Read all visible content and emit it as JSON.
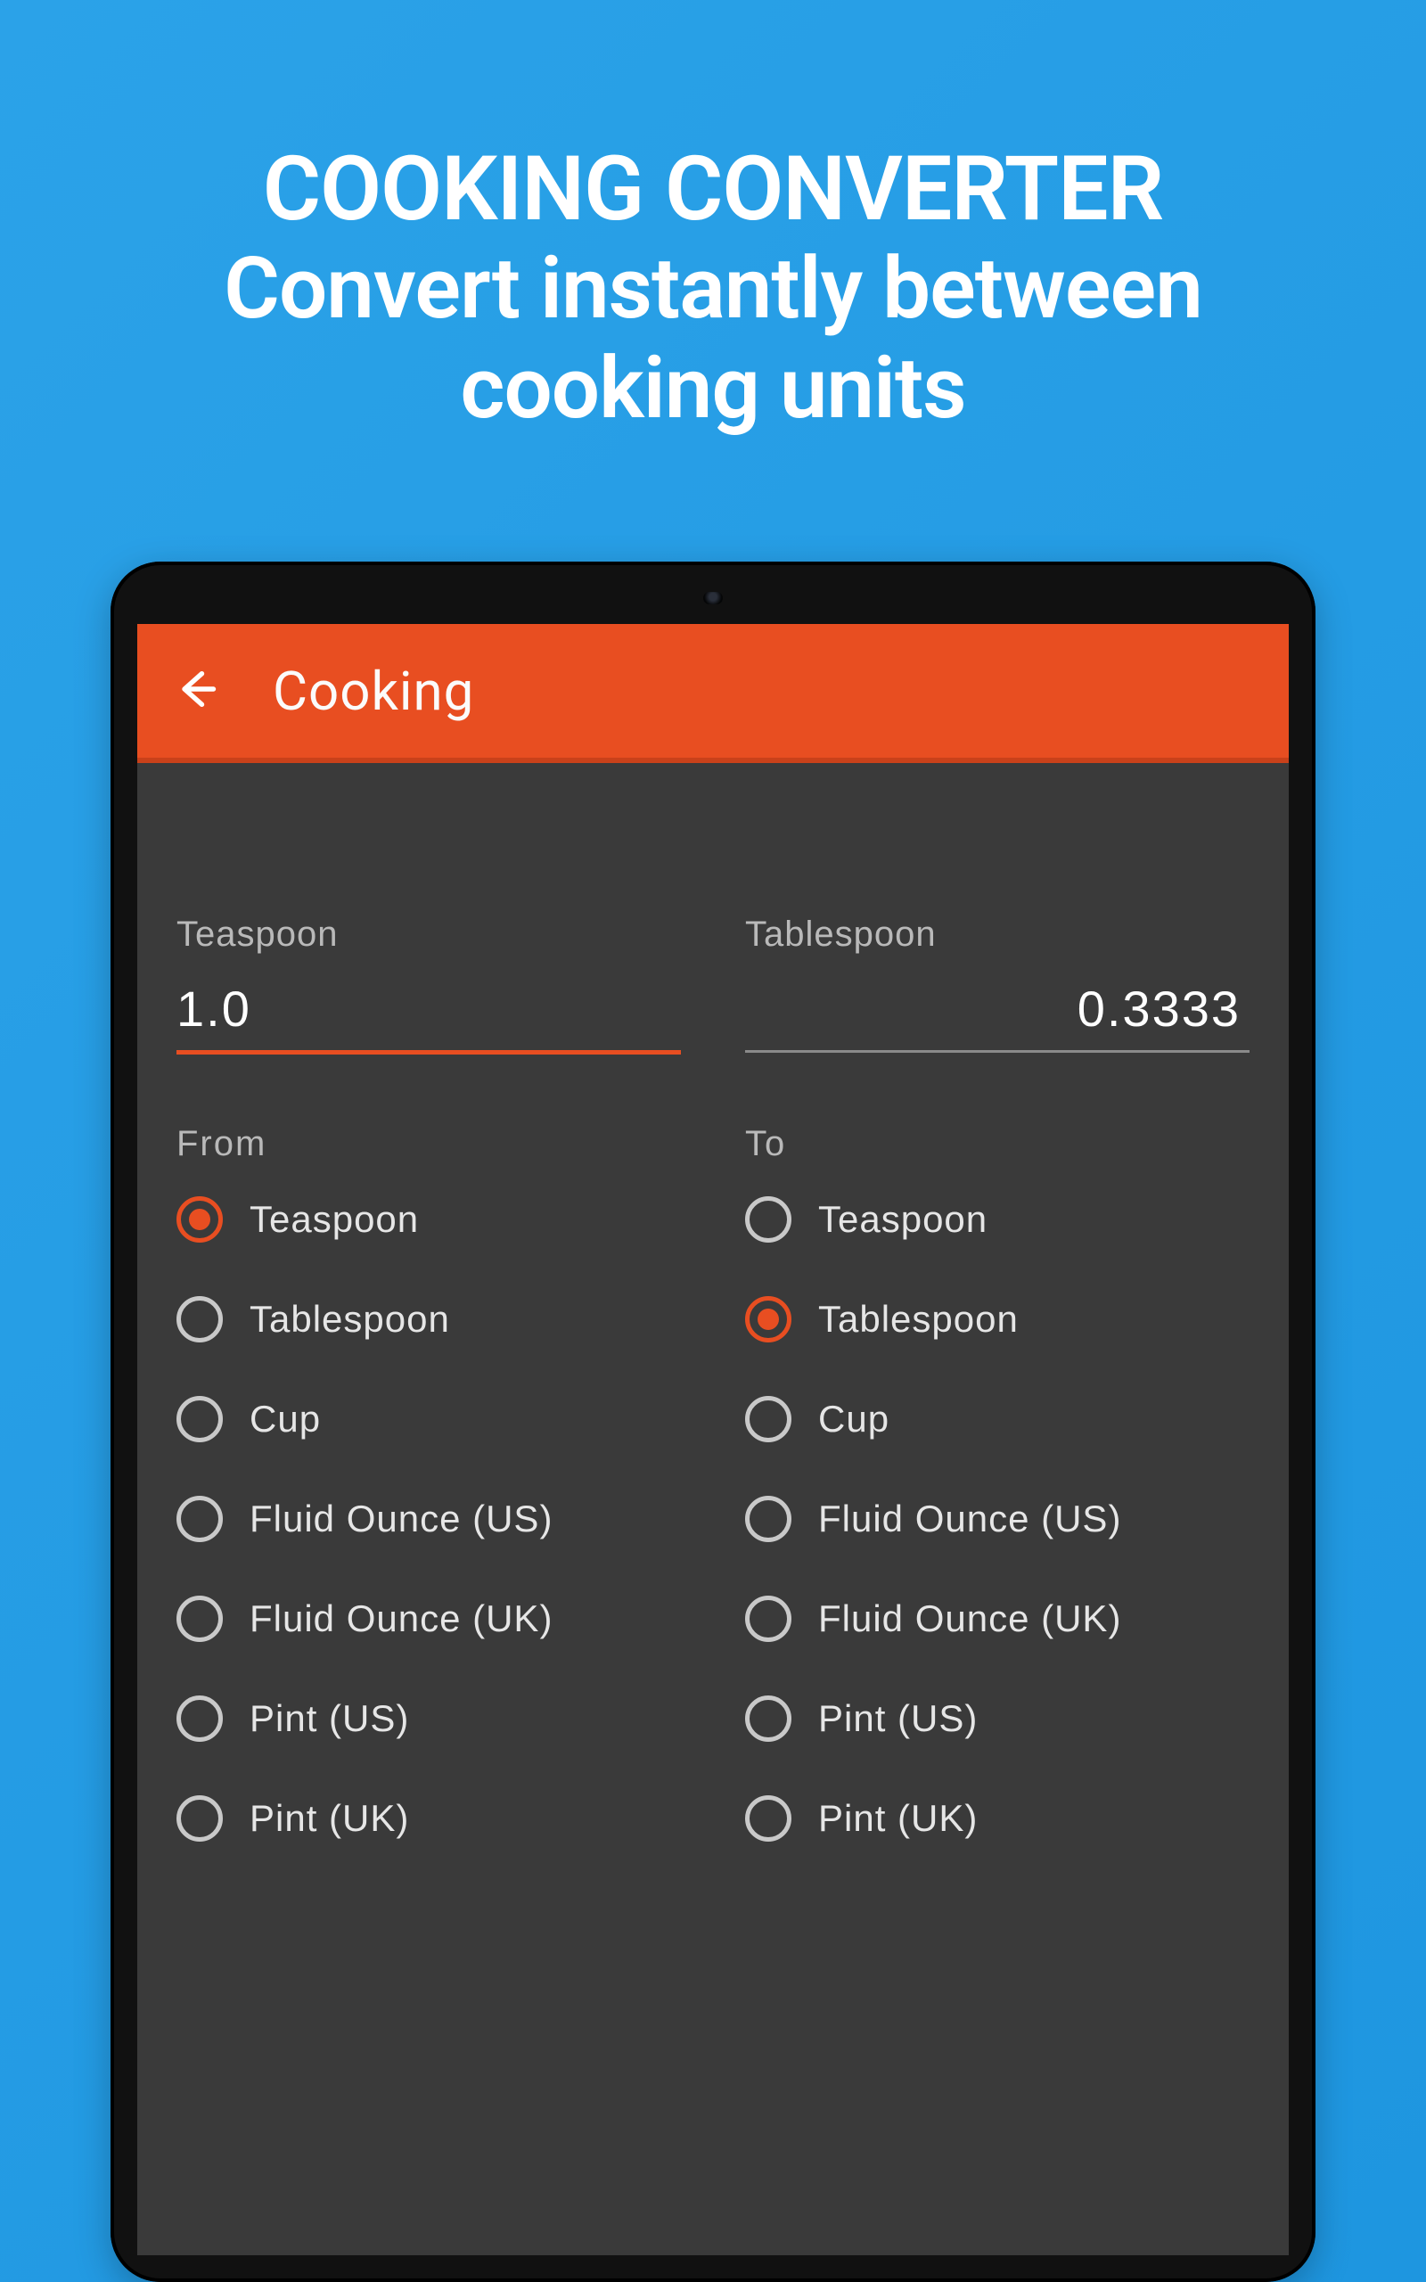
{
  "promo": {
    "title": "COOKING CONVERTER",
    "line1": "Convert instantly between",
    "line2": "cooking units"
  },
  "appbar": {
    "title": "Cooking"
  },
  "input": {
    "from_label": "Teaspoon",
    "to_label": "Tablespoon",
    "from_value": "1.0",
    "to_value": "0.3333"
  },
  "sections": {
    "from": "From",
    "to": "To"
  },
  "from_selected_index": 0,
  "to_selected_index": 1,
  "units": [
    "Teaspoon",
    "Tablespoon",
    "Cup",
    "Fluid Ounce (US)",
    "Fluid Ounce (UK)",
    "Pint (US)",
    "Pint (UK)"
  ]
}
